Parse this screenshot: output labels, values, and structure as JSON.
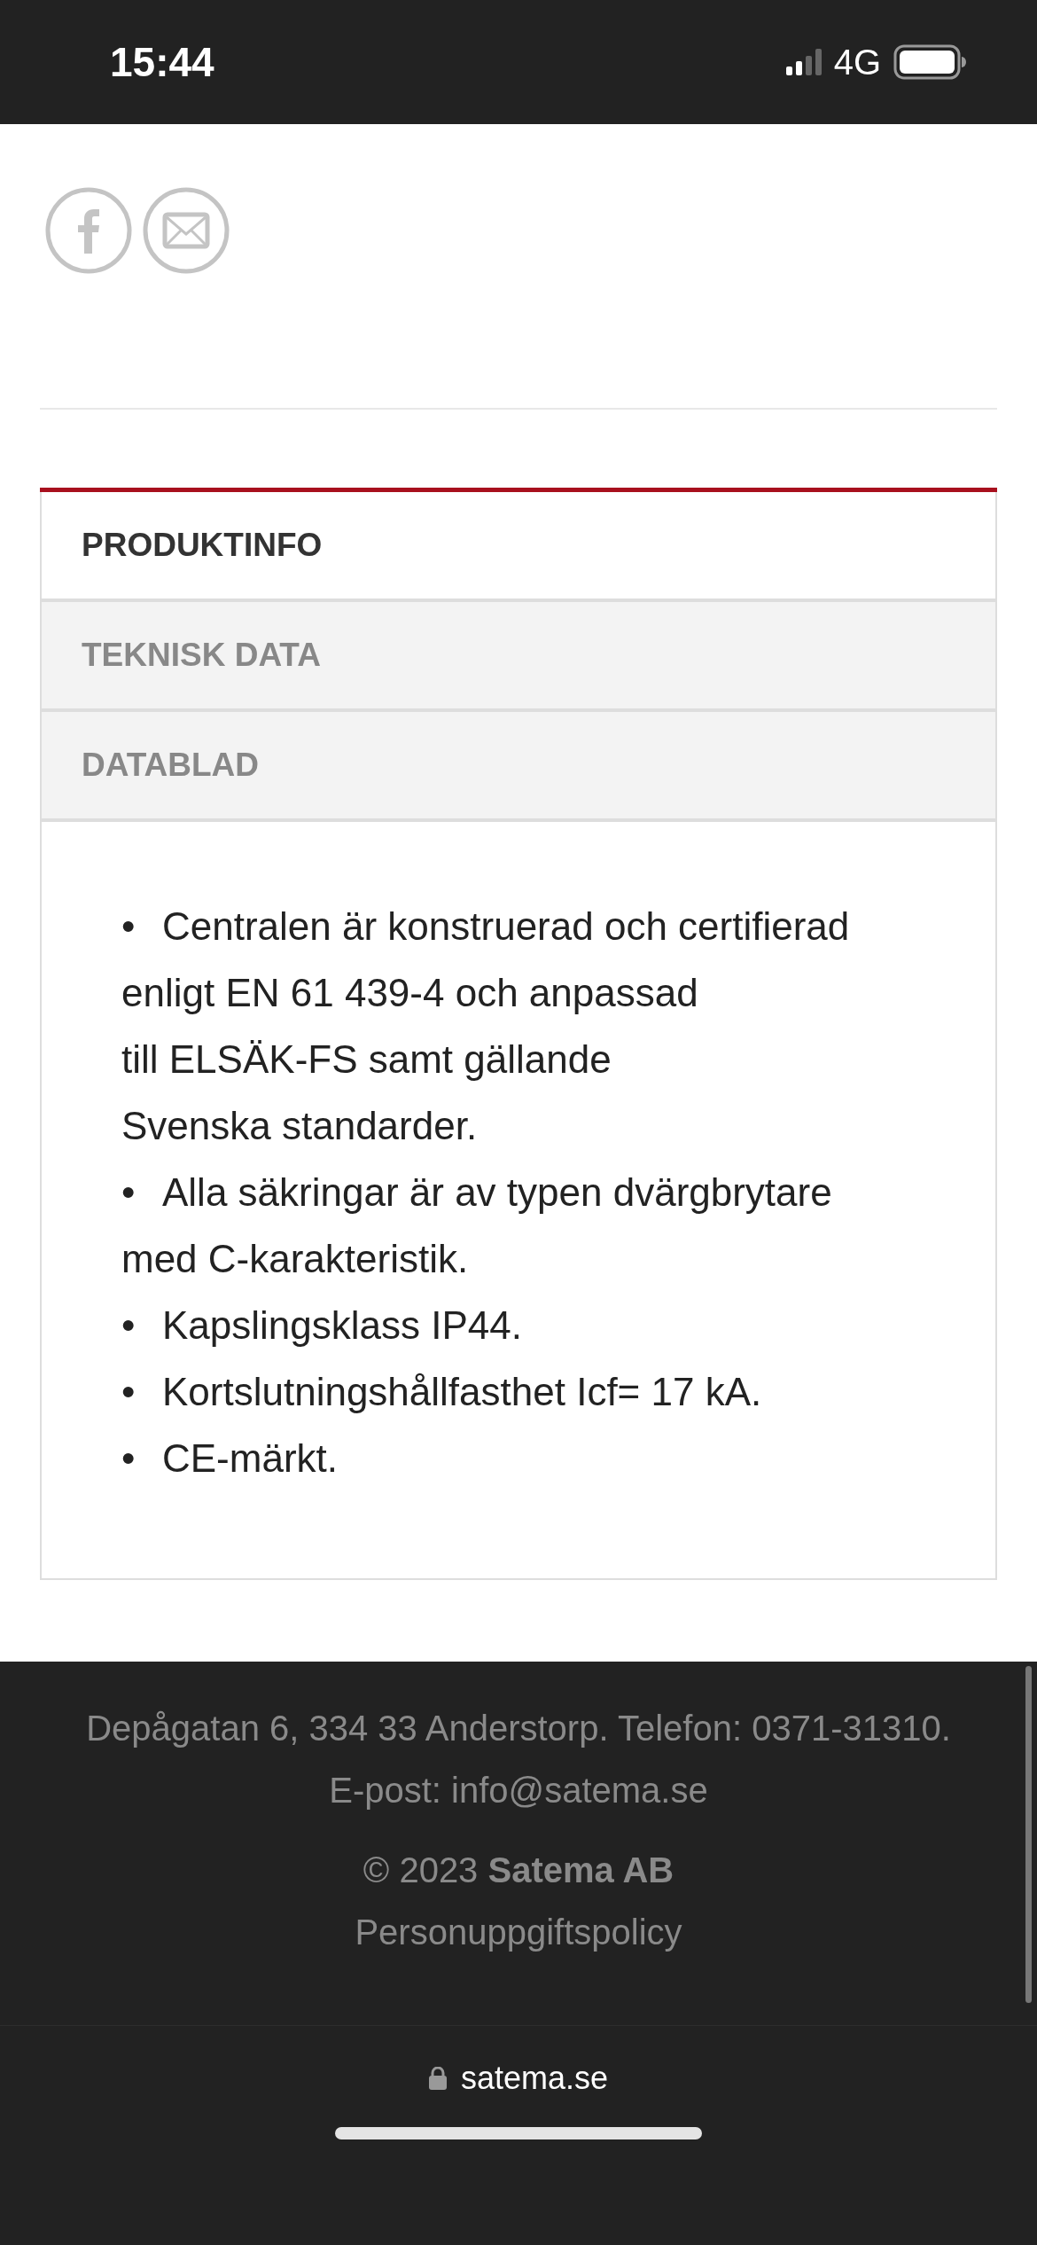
{
  "status_bar": {
    "time": "15:44",
    "network": "4G"
  },
  "tabs": [
    {
      "label": "PRODUKTINFO",
      "selected": true
    },
    {
      "label": "TEKNISK DATA",
      "selected": false
    },
    {
      "label": "DATABLAD",
      "selected": false
    }
  ],
  "product_info": [
    {
      "bullet": "•",
      "lines": [
        "Centralen är konstruerad och certifierad",
        "enligt EN 61 439-4 och anpassad",
        "till ELSÄK-FS samt gällande",
        "Svenska standarder."
      ]
    },
    {
      "bullet": "•",
      "lines": [
        "Alla säkringar är av typen dvärgbrytare",
        "med C-karakteristik."
      ]
    },
    {
      "bullet": "•",
      "lines": [
        "Kapslingsklass IP44."
      ]
    },
    {
      "bullet": "•",
      "lines": [
        "Kortslutningshållfasthet Icf= 17 kA."
      ]
    },
    {
      "bullet": "•",
      "lines": [
        "CE-märkt."
      ]
    }
  ],
  "footer": {
    "address": "Depågatan 6, 334 33 Anderstorp. Telefon: 0371-31310.",
    "email": "E-post: info@satema.se",
    "copyright": "© 2023 **Satema AB**",
    "policy_link": "Personuppgiftspolicy"
  },
  "browser_bar": {
    "url": "satema.se"
  }
}
